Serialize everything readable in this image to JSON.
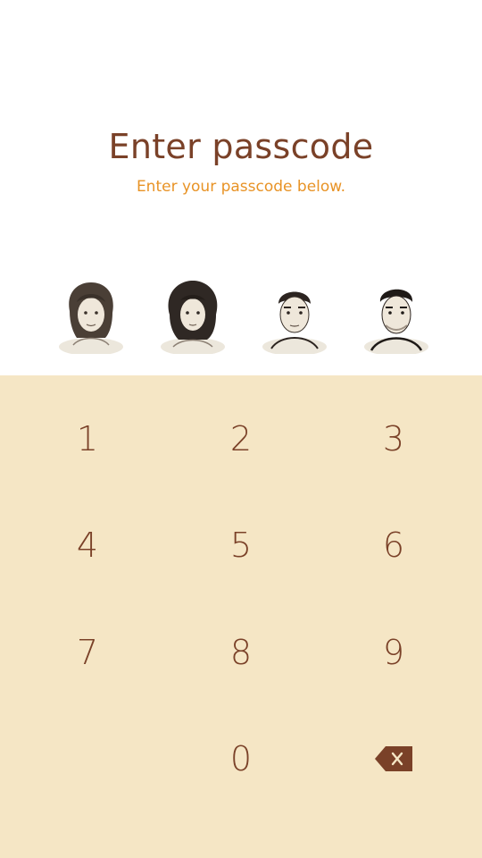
{
  "header": {
    "title": "Enter passcode",
    "subtitle": "Enter your passcode below."
  },
  "avatars": [
    {
      "name": "avatar-1",
      "icon": "sketch-portrait-long-hair"
    },
    {
      "name": "avatar-2",
      "icon": "sketch-portrait-curly-hair"
    },
    {
      "name": "avatar-3",
      "icon": "sketch-portrait-short-hair"
    },
    {
      "name": "avatar-4",
      "icon": "sketch-portrait-short-hair-beard"
    }
  ],
  "keypad": {
    "keys": [
      "1",
      "2",
      "3",
      "4",
      "5",
      "6",
      "7",
      "8",
      "9",
      "0"
    ],
    "backspace_icon": "backspace-icon"
  },
  "colors": {
    "title": "#7a4128",
    "subtitle": "#e89326",
    "keypad_bg": "#f5e6c5",
    "key_text": "#7a4128"
  }
}
